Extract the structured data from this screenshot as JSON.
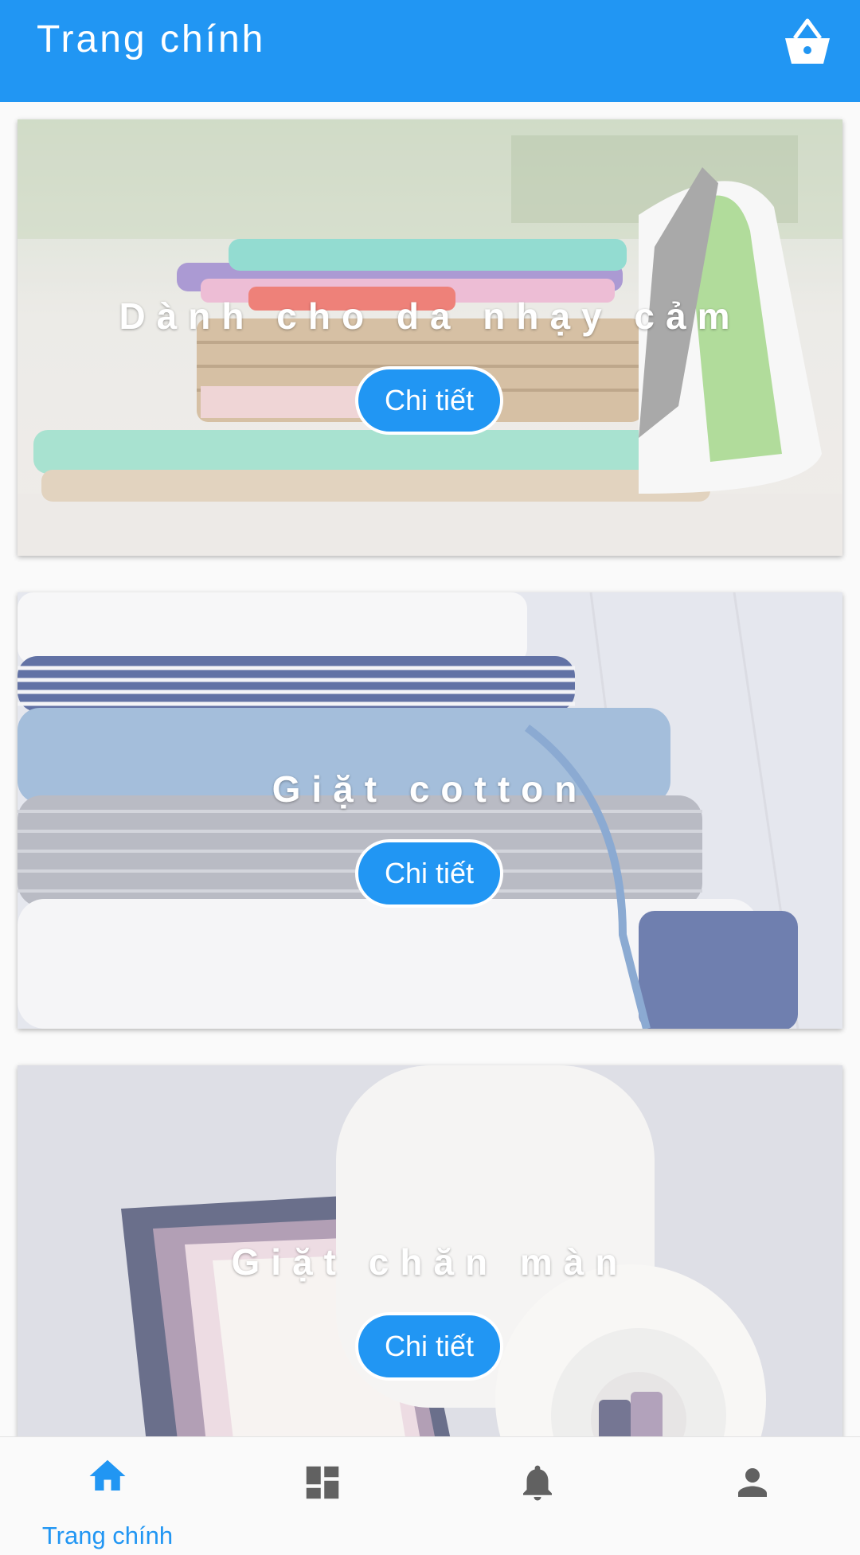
{
  "appbar": {
    "title": "Trang chính",
    "cart_icon": "shopping-basket-icon"
  },
  "cards": [
    {
      "title": "Dành cho da nhạy cảm",
      "button_label": "Chi tiết",
      "image": "folded-clothes-basket-iron"
    },
    {
      "title": "Giặt cotton",
      "button_label": "Chi tiết",
      "image": "folded-striped-cotton-stack"
    },
    {
      "title": "Giặt chăn màn",
      "button_label": "Chi tiết",
      "image": "rolled-blanket"
    }
  ],
  "bottom_nav": {
    "items": [
      {
        "icon": "home-icon",
        "label": "Trang chính",
        "active": true
      },
      {
        "icon": "dashboard-icon",
        "label": "",
        "active": false
      },
      {
        "icon": "bell-icon",
        "label": "",
        "active": false
      },
      {
        "icon": "person-icon",
        "label": "",
        "active": false
      }
    ]
  },
  "colors": {
    "primary": "#2196f3",
    "inactive": "#616161",
    "background": "#fafafa"
  }
}
